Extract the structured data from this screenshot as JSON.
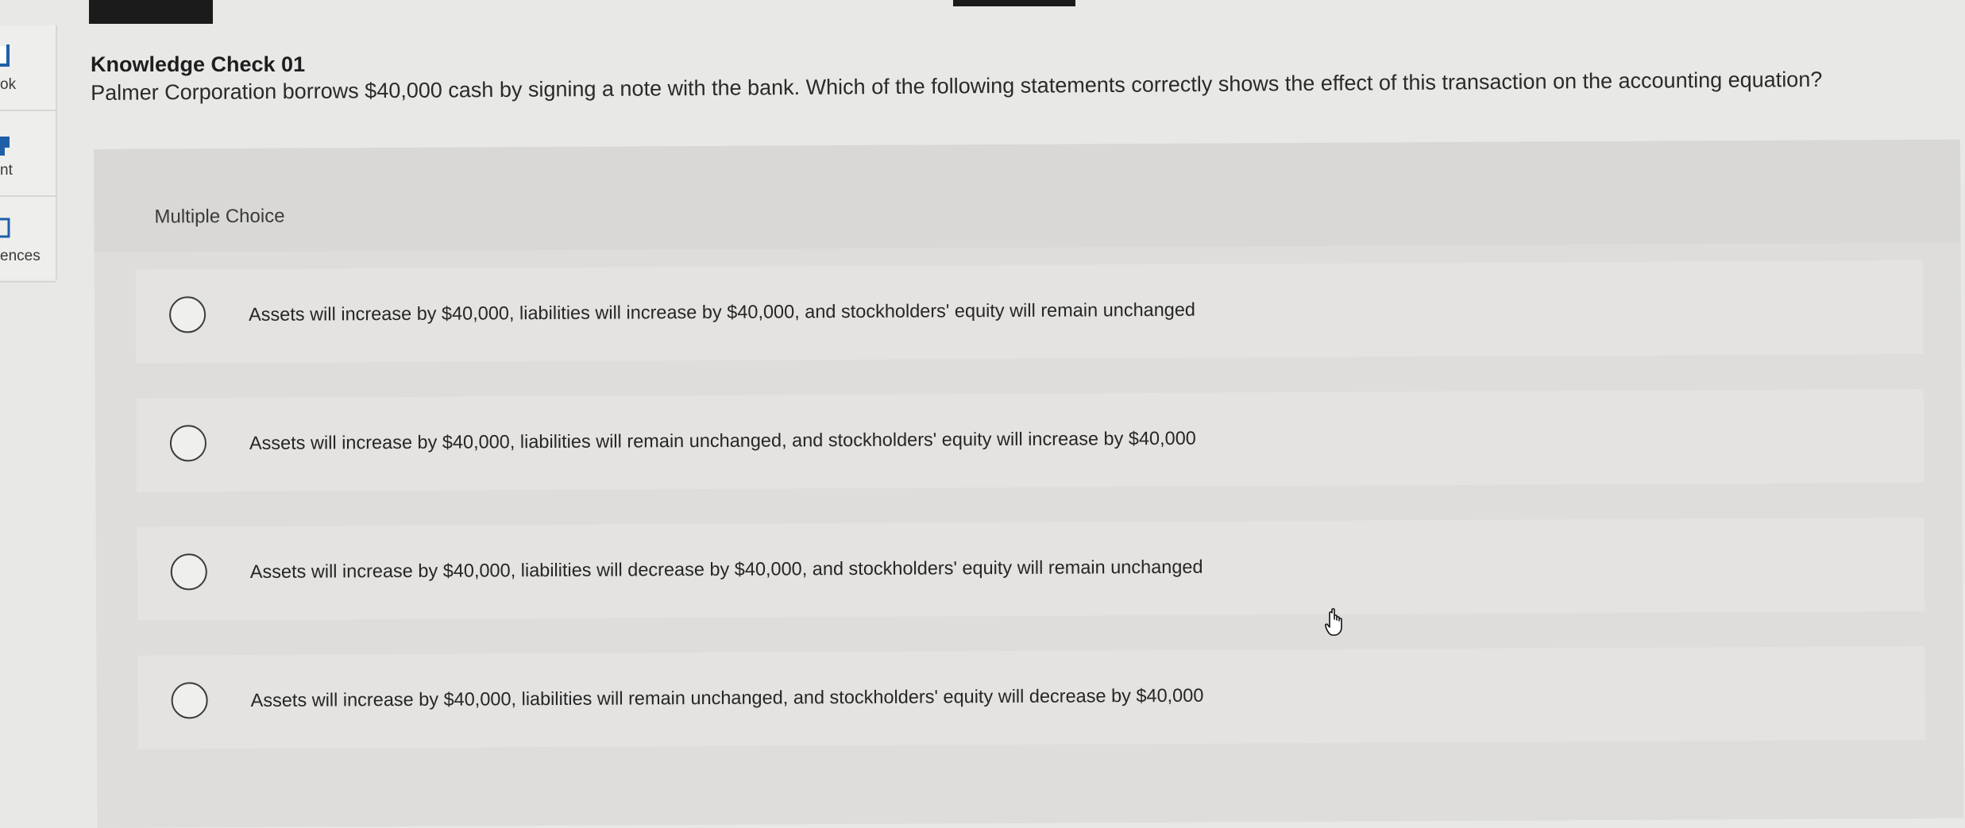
{
  "sidebar": {
    "items": [
      {
        "label": "ok",
        "icon": "book-icon"
      },
      {
        "label": "nt",
        "icon": "print-icon"
      },
      {
        "label": "ences",
        "icon": "document-icon"
      }
    ]
  },
  "question": {
    "title": "Knowledge Check 01",
    "text": "Palmer Corporation borrows $40,000 cash by signing a note with the bank. Which of the following statements correctly shows the effect of this transaction on the accounting equation?"
  },
  "answer_panel": {
    "type_label": "Multiple Choice",
    "options": [
      {
        "label": "Assets will increase by $40,000, liabilities will increase by $40,000, and stockholders' equity will remain unchanged",
        "selected": false
      },
      {
        "label": "Assets will increase by $40,000, liabilities will remain unchanged, and stockholders' equity will increase by $40,000",
        "selected": false
      },
      {
        "label": "Assets will increase by $40,000, liabilities will decrease by $40,000, and stockholders' equity will remain unchanged",
        "selected": false
      },
      {
        "label": "Assets will increase by $40,000, liabilities will remain unchanged, and stockholders' equity will decrease by $40,000",
        "selected": false
      }
    ]
  },
  "colors": {
    "page_background": "#e8e8e6",
    "panel_background": "#dedddb",
    "option_background": "#e4e3e1",
    "accent_blue": "#1f5fa8"
  },
  "cursor": {
    "icon": "hand-pointer-icon"
  }
}
